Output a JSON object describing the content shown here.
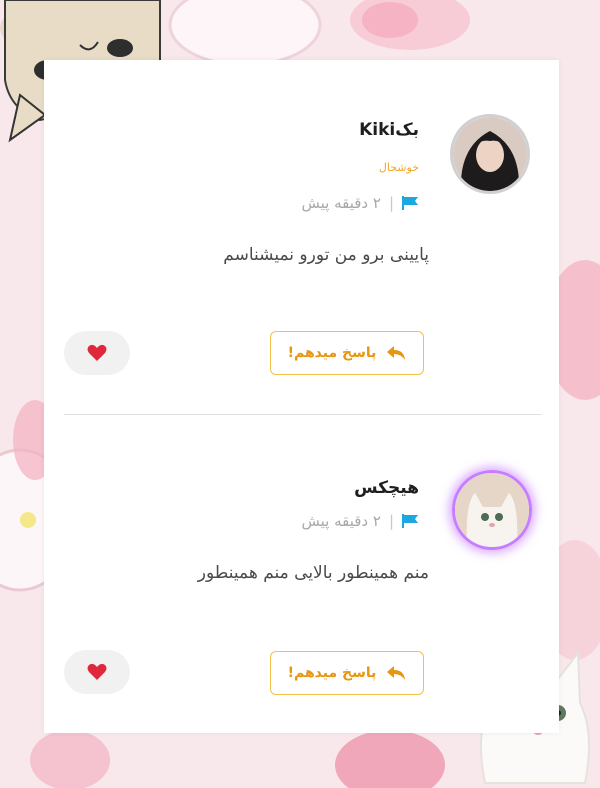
{
  "colors": {
    "accent": "#f5a623",
    "reply_border": "#f5c04a",
    "heart": "#e0283c",
    "flag": "#1ba8e0"
  },
  "comments": [
    {
      "username": "بکKiki",
      "mood": "خوشحال",
      "time": "۲ دقیقه پیش",
      "text": "پایینی برو من تورو نمیشناسم",
      "reply_label": "پاسخ میدهم!"
    },
    {
      "username": "هیچکس",
      "time": "۲ دقیقه پیش",
      "text": "منم همینطور بالایی منم همینطور",
      "reply_label": "پاسخ میدهم!"
    }
  ],
  "icons": {
    "flag": "flag-icon",
    "reply": "reply-arrow-icon",
    "heart": "heart-icon"
  }
}
